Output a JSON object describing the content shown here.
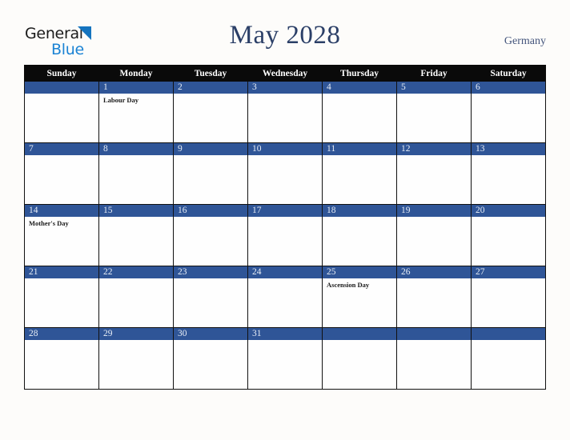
{
  "brand": {
    "line1": "General",
    "line2": "Blue",
    "triangle_color": "#1574bf",
    "line1_color": "#1b1b1b",
    "line2_color": "#1b83d4"
  },
  "header": {
    "title": "May 2028",
    "country": "Germany",
    "title_color": "#2b3f67",
    "country_color": "#44557c"
  },
  "calendar": {
    "weekday_headers": [
      "Sunday",
      "Monday",
      "Tuesday",
      "Wednesday",
      "Thursday",
      "Friday",
      "Saturday"
    ],
    "header_bg": "#0a0a0a",
    "header_text_color": "#ffffff",
    "daynum_bg": "#2f5597",
    "daynum_text_color": "#e8eef7",
    "cell_bg": "#fefefe",
    "weeks": [
      [
        {
          "day": "",
          "events": []
        },
        {
          "day": "1",
          "events": [
            "Labour Day"
          ]
        },
        {
          "day": "2",
          "events": []
        },
        {
          "day": "3",
          "events": []
        },
        {
          "day": "4",
          "events": []
        },
        {
          "day": "5",
          "events": []
        },
        {
          "day": "6",
          "events": []
        }
      ],
      [
        {
          "day": "7",
          "events": []
        },
        {
          "day": "8",
          "events": []
        },
        {
          "day": "9",
          "events": []
        },
        {
          "day": "10",
          "events": []
        },
        {
          "day": "11",
          "events": []
        },
        {
          "day": "12",
          "events": []
        },
        {
          "day": "13",
          "events": []
        }
      ],
      [
        {
          "day": "14",
          "events": [
            "Mother's Day"
          ]
        },
        {
          "day": "15",
          "events": []
        },
        {
          "day": "16",
          "events": []
        },
        {
          "day": "17",
          "events": []
        },
        {
          "day": "18",
          "events": []
        },
        {
          "day": "19",
          "events": []
        },
        {
          "day": "20",
          "events": []
        }
      ],
      [
        {
          "day": "21",
          "events": []
        },
        {
          "day": "22",
          "events": []
        },
        {
          "day": "23",
          "events": []
        },
        {
          "day": "24",
          "events": []
        },
        {
          "day": "25",
          "events": [
            "Ascension Day"
          ]
        },
        {
          "day": "26",
          "events": []
        },
        {
          "day": "27",
          "events": []
        }
      ],
      [
        {
          "day": "28",
          "events": []
        },
        {
          "day": "29",
          "events": []
        },
        {
          "day": "30",
          "events": []
        },
        {
          "day": "31",
          "events": []
        },
        {
          "day": "",
          "events": []
        },
        {
          "day": "",
          "events": []
        },
        {
          "day": "",
          "events": []
        }
      ]
    ]
  }
}
